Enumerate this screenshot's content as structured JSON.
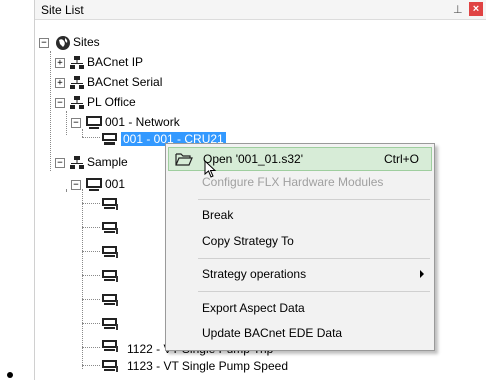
{
  "panel": {
    "title": "Site List",
    "pin_glyph": "⊥",
    "close_glyph": "×"
  },
  "tree": {
    "sites": "Sites",
    "bacnet_ip": "BACnet IP",
    "bacnet_serial": "BACnet Serial",
    "pl_office": "PL Office",
    "network_001": "001 - Network",
    "selected_item": "001 - 001 - CRU21",
    "sample": "Sample",
    "sample_001": "001",
    "item_1122": "1122 - VT Single Pump Trip",
    "item_1123": "1123 - VT Single Pump Speed",
    "expand_minus": "−",
    "expand_plus": "+"
  },
  "context_menu": {
    "open": {
      "label": "Open '001_01.s32'",
      "shortcut": "Ctrl+O"
    },
    "configure": "Configure FLX Hardware Modules",
    "break": "Break",
    "copy_strategy": "Copy Strategy To",
    "strategy_ops": "Strategy operations",
    "export_aspect": "Export Aspect Data",
    "update_bacnet": "Update BACnet EDE Data"
  },
  "colors": {
    "selection": "#3399ff",
    "hover": "#d7ecd7",
    "close": "#e04343"
  }
}
